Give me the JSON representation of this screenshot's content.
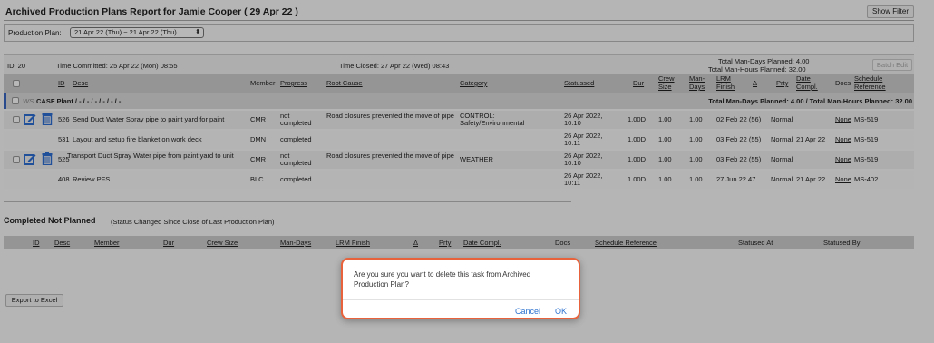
{
  "header": {
    "title": "Archived Production Plans Report for Jamie Cooper ( 29 Apr 22 )",
    "show_filter": "Show Filter"
  },
  "plan": {
    "label": "Production Plan:",
    "selected": "21 Apr 22 (Thu) ~ 21 Apr 22 (Thu)"
  },
  "info": {
    "id": "ID: 20",
    "time_committed": "Time Committed: 25 Apr 22 (Mon) 08:55",
    "time_closed": "Time Closed: 27 Apr 22 (Wed) 08:43",
    "total_man_days": "Total Man-Days Planned: 4.00",
    "total_man_hours": "Total Man-Hours Planned: 32.00",
    "batch_edit": "Batch Edit"
  },
  "columns": {
    "id": "ID",
    "desc": "Desc",
    "member": "Member",
    "progress": "Progress",
    "root_cause": "Root Cause",
    "category": "Category",
    "statussed": "Statussed",
    "dur": "Dur",
    "crew_size_1": "Crew",
    "crew_size_2": "Size",
    "man_days_1": "Man-",
    "man_days_2": "Days",
    "lrm_finish_1": "LRM",
    "lrm_finish_2": "Finish",
    "delta": "Δ",
    "prty": "Prty",
    "date_compl_1": "Date",
    "date_compl_2": "Compl.",
    "docs": "Docs",
    "schedule_ref_1": "Schedule",
    "schedule_ref_2": "Reference"
  },
  "group": {
    "ws": "WS",
    "name": "CASF Plant / - / - / - / - / - / -",
    "totals": "Total Man-Days Planned: 4.00 / Total Man-Hours Planned: 32.00"
  },
  "rows": [
    {
      "id": "526",
      "desc": "Send Duct Water Spray pipe to paint yard for paint",
      "member": "CMR",
      "progress": "not completed",
      "root_cause": "Road closures prevented the move of pipe",
      "category": "CONTROL: Safety/Environmental",
      "statussed": "26 Apr 2022, 10:10",
      "dur": "1.00D",
      "crew": "1.00",
      "man_days": "1.00",
      "lrm": "02 Feb 22 (56)",
      "prty": "Normal",
      "date_compl": "",
      "docs": "None",
      "sched": "MS-519"
    },
    {
      "id": "531",
      "desc": "Layout and setup fire blanket on work deck",
      "member": "DMN",
      "progress": "completed",
      "root_cause": "",
      "category": "",
      "statussed": "26 Apr 2022, 10:11",
      "dur": "1.00D",
      "crew": "1.00",
      "man_days": "1.00",
      "lrm": "03 Feb 22 (55)",
      "prty": "Normal",
      "date_compl": "21 Apr 22",
      "docs": "None",
      "sched": "MS-519"
    },
    {
      "id": "525",
      "desc": "Transport Duct Spray Water pipe from paint yard to unit",
      "member": "CMR",
      "progress": "not completed",
      "root_cause": "Road closures prevented the move of pipe",
      "category": "WEATHER",
      "statussed": "26 Apr 2022, 10:10",
      "dur": "1.00D",
      "crew": "1.00",
      "man_days": "1.00",
      "lrm": "03 Feb 22 (55)",
      "prty": "Normal",
      "date_compl": "",
      "docs": "None",
      "sched": "MS-519"
    },
    {
      "id": "408",
      "desc": "Review PFS",
      "member": "BLC",
      "progress": "completed",
      "root_cause": "",
      "category": "",
      "statussed": "26 Apr 2022, 10:11",
      "dur": "1.00D",
      "crew": "1.00",
      "man_days": "1.00",
      "lrm": "27 Jun 22 47",
      "prty": "Normal",
      "date_compl": "21 Apr 22",
      "docs": "None",
      "sched": "MS-402"
    }
  ],
  "cnp": {
    "title": "Completed Not Planned",
    "subtitle": "(Status Changed Since Close of Last Production Plan)",
    "columns": [
      "ID",
      "Desc",
      "Member",
      "Dur",
      "Crew Size",
      "Man-Days",
      "LRM Finish",
      "Δ",
      "Prty",
      "Date Compl.",
      "Docs",
      "Schedule Reference",
      "Statused At",
      "Statused By"
    ]
  },
  "export_label": "Export to Excel",
  "dialog": {
    "message": "Are you sure you want to delete this task from Archived Production Plan?",
    "cancel": "Cancel",
    "ok": "OK"
  }
}
